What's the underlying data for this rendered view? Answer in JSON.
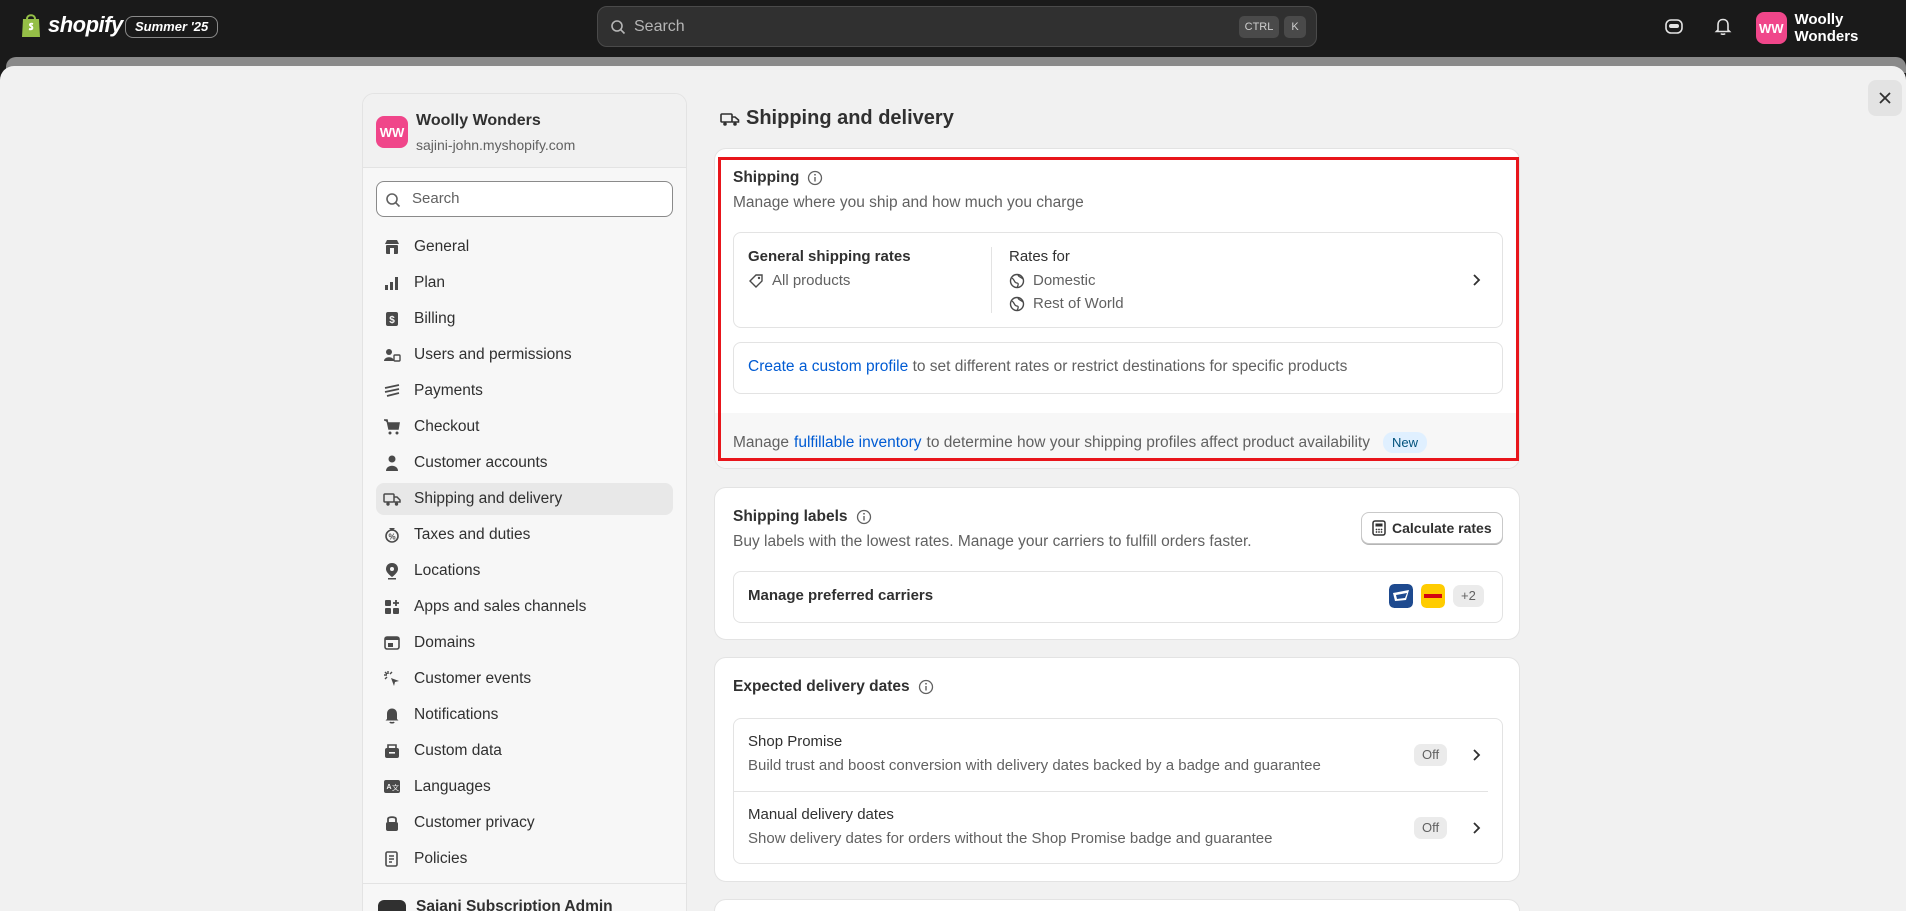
{
  "topbar": {
    "logo_text": "shopify",
    "edition": "Summer '25",
    "search_placeholder": "Search",
    "shortcut_ctrl": "CTRL",
    "shortcut_k": "K",
    "store_initials": "WW",
    "store_name": "Woolly Wonders"
  },
  "sidebar": {
    "store_initials": "WW",
    "store_name": "Woolly Wonders",
    "store_domain": "sajini-john.myshopify.com",
    "search_placeholder": "Search",
    "items": [
      {
        "label": "General",
        "icon": "store-icon"
      },
      {
        "label": "Plan",
        "icon": "plan-icon"
      },
      {
        "label": "Billing",
        "icon": "billing-icon"
      },
      {
        "label": "Users and permissions",
        "icon": "users-icon"
      },
      {
        "label": "Payments",
        "icon": "payments-icon"
      },
      {
        "label": "Checkout",
        "icon": "cart-icon"
      },
      {
        "label": "Customer accounts",
        "icon": "person-icon"
      },
      {
        "label": "Shipping and delivery",
        "icon": "truck-icon"
      },
      {
        "label": "Taxes and duties",
        "icon": "taxes-icon"
      },
      {
        "label": "Locations",
        "icon": "location-icon"
      },
      {
        "label": "Apps and sales channels",
        "icon": "apps-icon"
      },
      {
        "label": "Domains",
        "icon": "domains-icon"
      },
      {
        "label": "Customer events",
        "icon": "cursor-click-icon"
      },
      {
        "label": "Notifications",
        "icon": "bell-icon"
      },
      {
        "label": "Custom data",
        "icon": "custom-data-icon"
      },
      {
        "label": "Languages",
        "icon": "languages-icon"
      },
      {
        "label": "Customer privacy",
        "icon": "lock-icon"
      },
      {
        "label": "Policies",
        "icon": "policies-icon"
      }
    ],
    "active_item": "Shipping and delivery",
    "bottom_app": "Sajani Subscription Admin"
  },
  "main": {
    "page_title": "Shipping and delivery",
    "shipping": {
      "title": "Shipping",
      "subtitle": "Manage where you ship and how much you charge",
      "general_rates_title": "General shipping rates",
      "all_products": "All products",
      "rates_for_title": "Rates for",
      "zone_domestic": "Domestic",
      "zone_rest": "Rest of World",
      "custom_profile_link": "Create a custom profile",
      "custom_profile_text": "to set different rates or restrict destinations for specific products",
      "inventory_prefix": "Manage",
      "inventory_link": "fulfillable inventory",
      "inventory_suffix": "to determine how your shipping profiles affect product availability",
      "new_badge": "New"
    },
    "labels": {
      "title": "Shipping labels",
      "subtitle": "Buy labels with the lowest rates. Manage your carriers to fulfill orders faster.",
      "calculate_button": "Calculate rates",
      "carriers_row": "Manage preferred carriers",
      "more_carriers": "+2"
    },
    "delivery_dates": {
      "title": "Expected delivery dates",
      "shop_promise_title": "Shop Promise",
      "shop_promise_sub": "Build trust and boost conversion with delivery dates backed by a badge and guarantee",
      "shop_promise_status": "Off",
      "manual_title": "Manual delivery dates",
      "manual_sub": "Show delivery dates for orders without the Shop Promise badge and guarantee",
      "manual_status": "Off"
    }
  },
  "colors": {
    "link": "#005bd3",
    "highlight": "#e8151b",
    "avatar": "#f0468a",
    "topbar": "#1a1a1a"
  }
}
